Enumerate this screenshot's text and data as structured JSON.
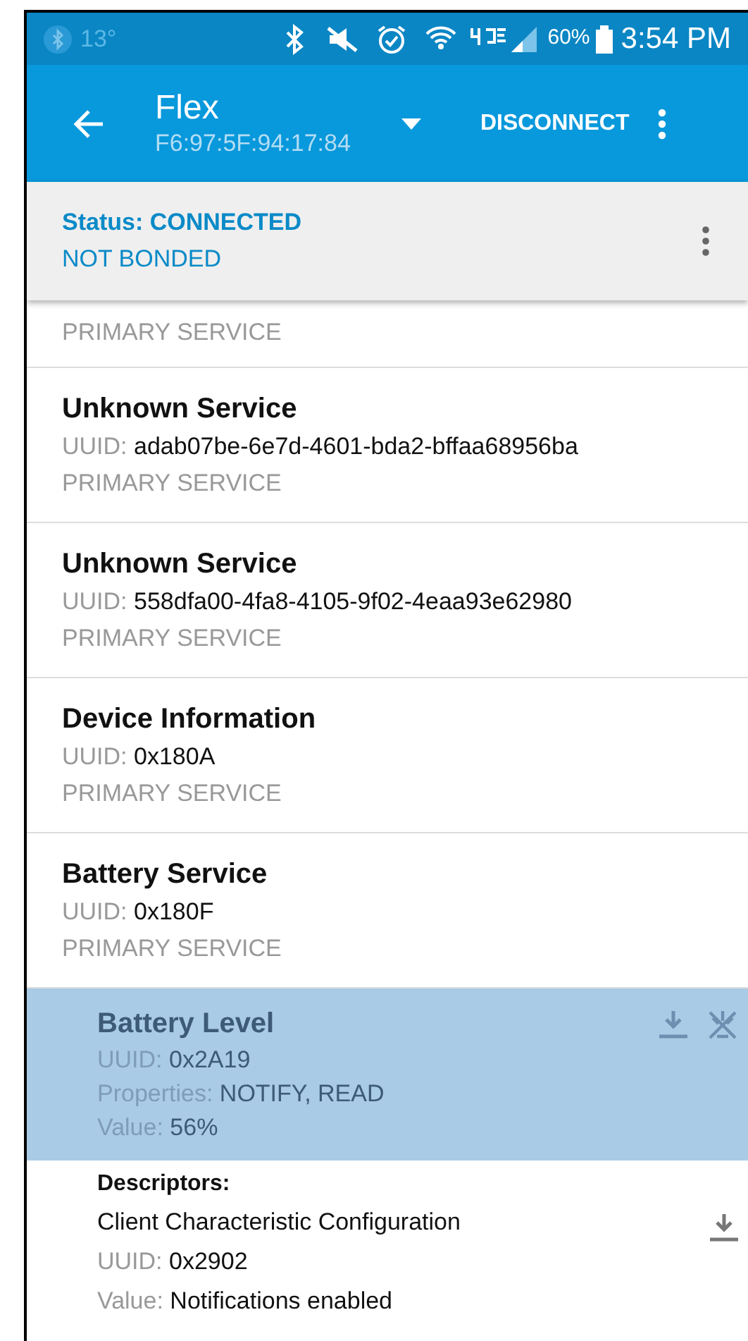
{
  "status_bar": {
    "temperature": "13°",
    "battery": "60%",
    "time": "3:54 PM"
  },
  "toolbar": {
    "title": "Flex",
    "subtitle": "F6:97:5F:94:17:84",
    "action": "DISCONNECT"
  },
  "connection": {
    "status": "Status: CONNECTED",
    "bond": "NOT BONDED"
  },
  "services": [
    {
      "type": "PRIMARY SERVICE"
    },
    {
      "name": "Unknown Service",
      "uuid_label": "UUID:",
      "uuid": "adab07be-6e7d-4601-bda2-bffaa68956ba",
      "type": "PRIMARY SERVICE"
    },
    {
      "name": "Unknown Service",
      "uuid_label": "UUID:",
      "uuid": "558dfa00-4fa8-4105-9f02-4eaa93e62980",
      "type": "PRIMARY SERVICE"
    },
    {
      "name": "Device Information",
      "uuid_label": "UUID:",
      "uuid": "0x180A",
      "type": "PRIMARY SERVICE"
    },
    {
      "name": "Battery Service",
      "uuid_label": "UUID:",
      "uuid": "0x180F",
      "type": "PRIMARY SERVICE"
    }
  ],
  "characteristic": {
    "name": "Battery Level",
    "selected": true,
    "rows": [
      {
        "label": "UUID:",
        "value": "0x2A19"
      },
      {
        "label": "Properties:",
        "value": "NOTIFY, READ"
      },
      {
        "label": "Value:",
        "value": "56%"
      }
    ]
  },
  "descriptors": {
    "heading": "Descriptors:",
    "items": [
      {
        "name": "Client Characteristic Configuration",
        "rows": [
          {
            "label": "UUID:",
            "value": "0x2902"
          },
          {
            "label": "Value:",
            "value": "Notifications enabled"
          }
        ]
      }
    ]
  }
}
